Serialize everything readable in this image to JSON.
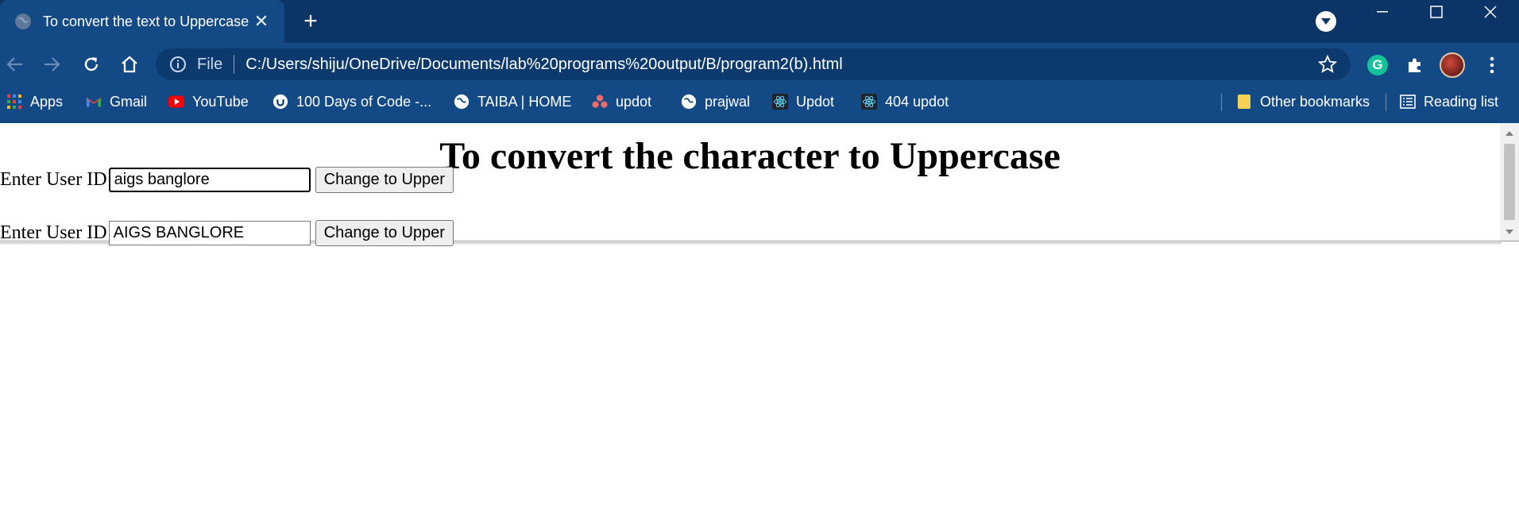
{
  "tab": {
    "title": "To convert the text to Uppercase"
  },
  "toolbar": {
    "scheme": "File",
    "url": "C:/Users/shiju/OneDrive/Documents/lab%20programs%20output/B/program2(b).html"
  },
  "bookmarks": {
    "items": [
      {
        "label": "Apps",
        "icon": "apps-grid-icon"
      },
      {
        "label": "Gmail",
        "icon": "gmail-icon"
      },
      {
        "label": "YouTube",
        "icon": "youtube-icon"
      },
      {
        "label": "100 Days of Code -...",
        "icon": "udemy-icon"
      },
      {
        "label": "TAIBA | HOME",
        "icon": "globe-icon"
      },
      {
        "label": "updot",
        "icon": "asana-icon"
      },
      {
        "label": "prajwal",
        "icon": "globe-icon"
      },
      {
        "label": "Updot",
        "icon": "react-icon"
      },
      {
        "label": "404 updot",
        "icon": "react-icon"
      }
    ],
    "other": "Other bookmarks",
    "reading_list": "Reading list"
  },
  "page": {
    "heading": "To convert the character to Uppercase",
    "rows": [
      {
        "label": "Enter User ID",
        "value": "aigs banglore",
        "button": "Change to Upper"
      },
      {
        "label": "Enter User ID",
        "value": "AIGS BANGLORE",
        "button": "Change to Upper"
      }
    ]
  },
  "colors": {
    "tabstrip": "#0b3566",
    "toolbar": "#134a86",
    "omnibox": "#0c3a6e",
    "grammarly": "#15c39a"
  }
}
